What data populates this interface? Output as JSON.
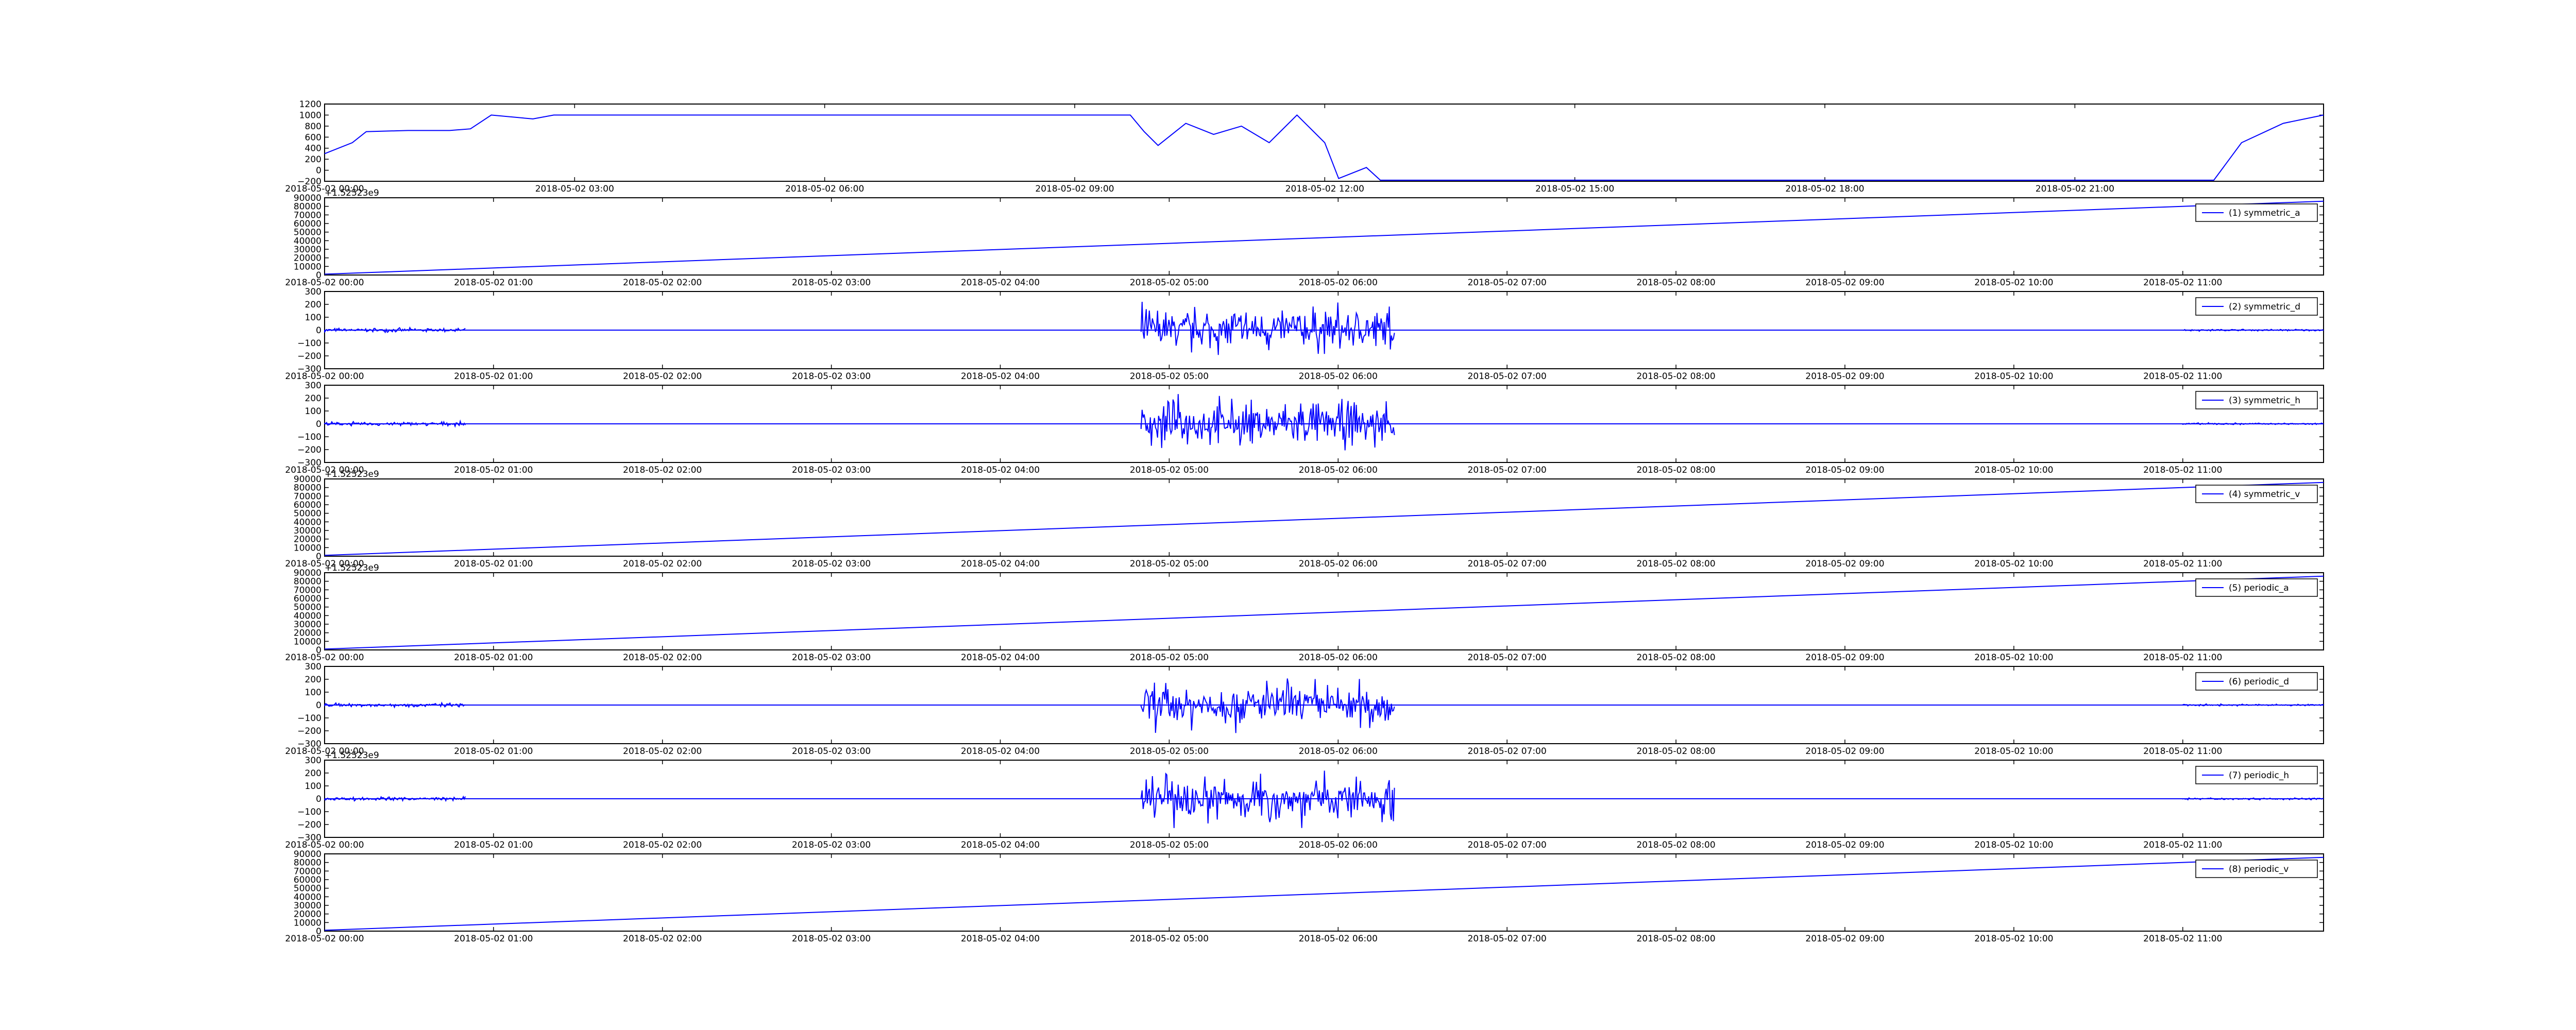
{
  "figure": {
    "line_color": "#0000ff",
    "frame_color": "#000000"
  },
  "chart_data": [
    {
      "type": "line",
      "x_kind": "date",
      "xlim": [
        "2018-05-02 00:00",
        "2018-05-02 23:59"
      ],
      "ylim": [
        -200,
        1200
      ],
      "yticks": [
        -200,
        0,
        200,
        400,
        600,
        800,
        1000,
        1200
      ],
      "xticks": [
        "2018-05-02 00:00",
        "2018-05-02 03:00",
        "2018-05-02 06:00",
        "2018-05-02 09:00",
        "2018-05-02 12:00",
        "2018-05-02 15:00",
        "2018-05-02 18:00",
        "2018-05-02 21:00"
      ],
      "xlabel": "",
      "ylabel": "",
      "series": [
        {
          "x": [
            "2018-05-02 00:00",
            "2018-05-02 00:20",
            "2018-05-02 00:30",
            "2018-05-02 01:00",
            "2018-05-02 01:30",
            "2018-05-02 01:45",
            "2018-05-02 02:00",
            "2018-05-02 02:30",
            "2018-05-02 02:45",
            "2018-05-02 09:40",
            "2018-05-02 09:50",
            "2018-05-02 10:00",
            "2018-05-02 10:20",
            "2018-05-02 10:40",
            "2018-05-02 11:00",
            "2018-05-02 11:20",
            "2018-05-02 11:40",
            "2018-05-02 12:00",
            "2018-05-02 12:10",
            "2018-05-02 12:30",
            "2018-05-02 12:40",
            "2018-05-02 22:40",
            "2018-05-02 23:00",
            "2018-05-02 23:30",
            "2018-05-02 23:59"
          ],
          "y": [
            300,
            500,
            700,
            720,
            720,
            750,
            1000,
            930,
            1000,
            1000,
            700,
            450,
            850,
            650,
            800,
            500,
            1000,
            500,
            -150,
            50,
            -180,
            -180,
            500,
            850,
            1000
          ]
        }
      ]
    },
    {
      "type": "line",
      "x_kind": "date",
      "xlim": [
        "2018-05-02 00:00",
        "2018-05-02 11:50"
      ],
      "ylim": [
        0,
        90000
      ],
      "yticks": [
        0,
        10000,
        20000,
        30000,
        40000,
        50000,
        60000,
        70000,
        80000,
        90000
      ],
      "offset_text": "+1.52523e9",
      "xticks": [
        "2018-05-02 00:00",
        "2018-05-02 01:00",
        "2018-05-02 02:00",
        "2018-05-02 03:00",
        "2018-05-02 04:00",
        "2018-05-02 05:00",
        "2018-05-02 06:00",
        "2018-05-02 07:00",
        "2018-05-02 08:00",
        "2018-05-02 09:00",
        "2018-05-02 10:00",
        "2018-05-02 11:00"
      ],
      "series": [
        {
          "name": "(1) symmetric_a",
          "x": [
            "2018-05-02 00:00",
            "2018-05-02 11:50"
          ],
          "y": [
            1000,
            86000
          ]
        }
      ],
      "legend": "top-right"
    },
    {
      "type": "line",
      "x_kind": "date",
      "xlim": [
        "2018-05-02 00:00",
        "2018-05-02 11:50"
      ],
      "ylim": [
        -300,
        300
      ],
      "yticks": [
        -300,
        -200,
        -100,
        0,
        100,
        200,
        300
      ],
      "xticks": [
        "2018-05-02 00:00",
        "2018-05-02 01:00",
        "2018-05-02 02:00",
        "2018-05-02 03:00",
        "2018-05-02 04:00",
        "2018-05-02 05:00",
        "2018-05-02 06:00",
        "2018-05-02 07:00",
        "2018-05-02 08:00",
        "2018-05-02 09:00",
        "2018-05-02 10:00",
        "2018-05-02 11:00"
      ],
      "series": [
        {
          "name": "(2) symmetric_d",
          "baseline": 0,
          "bursts": [
            {
              "from": "2018-05-02 00:00",
              "to": "2018-05-02 00:50",
              "amp": 20
            },
            {
              "from": "2018-05-02 04:50",
              "to": "2018-05-02 06:20",
              "amp": 250
            },
            {
              "from": "2018-05-02 11:00",
              "to": "2018-05-02 11:50",
              "amp": 10
            }
          ]
        }
      ],
      "legend": "top-right"
    },
    {
      "type": "line",
      "x_kind": "date",
      "xlim": [
        "2018-05-02 00:00",
        "2018-05-02 11:50"
      ],
      "ylim": [
        -300,
        300
      ],
      "yticks": [
        -300,
        -200,
        -100,
        0,
        100,
        200,
        300
      ],
      "xticks": [
        "2018-05-02 00:00",
        "2018-05-02 01:00",
        "2018-05-02 02:00",
        "2018-05-02 03:00",
        "2018-05-02 04:00",
        "2018-05-02 05:00",
        "2018-05-02 06:00",
        "2018-05-02 07:00",
        "2018-05-02 08:00",
        "2018-05-02 09:00",
        "2018-05-02 10:00",
        "2018-05-02 11:00"
      ],
      "series": [
        {
          "name": "(3) symmetric_h",
          "baseline": 0,
          "bursts": [
            {
              "from": "2018-05-02 00:00",
              "to": "2018-05-02 00:50",
              "amp": 20
            },
            {
              "from": "2018-05-02 04:50",
              "to": "2018-05-02 06:20",
              "amp": 250
            },
            {
              "from": "2018-05-02 11:00",
              "to": "2018-05-02 11:50",
              "amp": 10
            }
          ]
        }
      ],
      "legend": "top-right"
    },
    {
      "type": "line",
      "x_kind": "date",
      "xlim": [
        "2018-05-02 00:00",
        "2018-05-02 11:50"
      ],
      "ylim": [
        0,
        90000
      ],
      "yticks": [
        0,
        10000,
        20000,
        30000,
        40000,
        50000,
        60000,
        70000,
        80000,
        90000
      ],
      "offset_text": "+1.52523e9",
      "xticks": [
        "2018-05-02 00:00",
        "2018-05-02 01:00",
        "2018-05-02 02:00",
        "2018-05-02 03:00",
        "2018-05-02 04:00",
        "2018-05-02 05:00",
        "2018-05-02 06:00",
        "2018-05-02 07:00",
        "2018-05-02 08:00",
        "2018-05-02 09:00",
        "2018-05-02 10:00",
        "2018-05-02 11:00"
      ],
      "series": [
        {
          "name": "(4) symmetric_v",
          "x": [
            "2018-05-02 00:00",
            "2018-05-02 11:50"
          ],
          "y": [
            1000,
            86000
          ]
        }
      ],
      "legend": "top-right"
    },
    {
      "type": "line",
      "x_kind": "date",
      "xlim": [
        "2018-05-02 00:00",
        "2018-05-02 11:50"
      ],
      "ylim": [
        0,
        90000
      ],
      "yticks": [
        0,
        10000,
        20000,
        30000,
        40000,
        50000,
        60000,
        70000,
        80000,
        90000
      ],
      "offset_text": "+1.52523e9",
      "xticks": [
        "2018-05-02 00:00",
        "2018-05-02 01:00",
        "2018-05-02 02:00",
        "2018-05-02 03:00",
        "2018-05-02 04:00",
        "2018-05-02 05:00",
        "2018-05-02 06:00",
        "2018-05-02 07:00",
        "2018-05-02 08:00",
        "2018-05-02 09:00",
        "2018-05-02 10:00",
        "2018-05-02 11:00"
      ],
      "series": [
        {
          "name": "(5) periodic_a",
          "x": [
            "2018-05-02 00:00",
            "2018-05-02 11:50"
          ],
          "y": [
            1000,
            86000
          ]
        }
      ],
      "legend": "top-right"
    },
    {
      "type": "line",
      "x_kind": "date",
      "xlim": [
        "2018-05-02 00:00",
        "2018-05-02 11:50"
      ],
      "ylim": [
        -300,
        300
      ],
      "yticks": [
        -300,
        -200,
        -100,
        0,
        100,
        200,
        300
      ],
      "xticks": [
        "2018-05-02 00:00",
        "2018-05-02 01:00",
        "2018-05-02 02:00",
        "2018-05-02 03:00",
        "2018-05-02 04:00",
        "2018-05-02 05:00",
        "2018-05-02 06:00",
        "2018-05-02 07:00",
        "2018-05-02 08:00",
        "2018-05-02 09:00",
        "2018-05-02 10:00",
        "2018-05-02 11:00"
      ],
      "series": [
        {
          "name": "(6) periodic_d",
          "baseline": 0,
          "bursts": [
            {
              "from": "2018-05-02 00:00",
              "to": "2018-05-02 00:50",
              "amp": 20
            },
            {
              "from": "2018-05-02 04:50",
              "to": "2018-05-02 06:20",
              "amp": 250
            },
            {
              "from": "2018-05-02 11:00",
              "to": "2018-05-02 11:50",
              "amp": 10
            }
          ]
        }
      ],
      "legend": "top-right"
    },
    {
      "type": "line",
      "x_kind": "date",
      "xlim": [
        "2018-05-02 00:00",
        "2018-05-02 11:50"
      ],
      "ylim": [
        -300,
        300
      ],
      "yticks": [
        -300,
        -200,
        -100,
        0,
        100,
        200,
        300
      ],
      "offset_text": "+1.52523e9",
      "xticks": [
        "2018-05-02 00:00",
        "2018-05-02 01:00",
        "2018-05-02 02:00",
        "2018-05-02 03:00",
        "2018-05-02 04:00",
        "2018-05-02 05:00",
        "2018-05-02 06:00",
        "2018-05-02 07:00",
        "2018-05-02 08:00",
        "2018-05-02 09:00",
        "2018-05-02 10:00",
        "2018-05-02 11:00"
      ],
      "series": [
        {
          "name": "(7) periodic_h",
          "baseline": 0,
          "bursts": [
            {
              "from": "2018-05-02 00:00",
              "to": "2018-05-02 00:50",
              "amp": 20
            },
            {
              "from": "2018-05-02 04:50",
              "to": "2018-05-02 06:20",
              "amp": 250
            },
            {
              "from": "2018-05-02 11:00",
              "to": "2018-05-02 11:50",
              "amp": 10
            }
          ]
        }
      ],
      "legend": "top-right"
    },
    {
      "type": "line",
      "x_kind": "date",
      "xlim": [
        "2018-05-02 00:00",
        "2018-05-02 11:50"
      ],
      "ylim": [
        0,
        90000
      ],
      "yticks": [
        0,
        10000,
        20000,
        30000,
        40000,
        50000,
        60000,
        70000,
        80000,
        90000
      ],
      "xticks": [
        "2018-05-02 00:00",
        "2018-05-02 01:00",
        "2018-05-02 02:00",
        "2018-05-02 03:00",
        "2018-05-02 04:00",
        "2018-05-02 05:00",
        "2018-05-02 06:00",
        "2018-05-02 07:00",
        "2018-05-02 08:00",
        "2018-05-02 09:00",
        "2018-05-02 10:00",
        "2018-05-02 11:00"
      ],
      "series": [
        {
          "name": "(8) periodic_v",
          "x": [
            "2018-05-02 00:00",
            "2018-05-02 11:50"
          ],
          "y": [
            1000,
            86000
          ]
        }
      ],
      "legend": "top-right"
    }
  ]
}
